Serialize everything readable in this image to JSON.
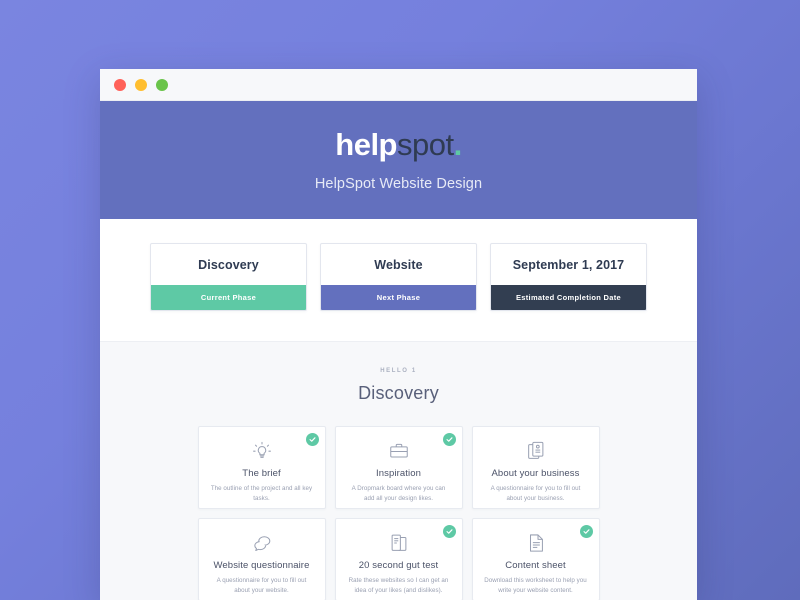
{
  "window": {
    "traffic_lights": [
      "close-red",
      "minimize-yellow",
      "maximize-green"
    ]
  },
  "hero": {
    "logo_part1": "help",
    "logo_part2": "spot",
    "logo_dot": ".",
    "subtitle": "HelpSpot Website Design",
    "background_color": "#6370be"
  },
  "phases": [
    {
      "title": "Discovery",
      "band_label": "Current Phase",
      "band_color": "#5ec9a5"
    },
    {
      "title": "Website",
      "band_label": "Next Phase",
      "band_color": "#6370be"
    },
    {
      "title": "September 1, 2017",
      "band_label": "Estimated Completion Date",
      "band_color": "#323e51"
    }
  ],
  "section": {
    "eyebrow": "HELLO 1",
    "heading": "Discovery"
  },
  "tasks": [
    {
      "icon": "lightbulb-icon",
      "title": "The brief",
      "description": "The outline of the project and all key tasks.",
      "completed": true
    },
    {
      "icon": "briefcase-icon",
      "title": "Inspiration",
      "description": "A Dropmark board where you can add all your design likes.",
      "completed": true
    },
    {
      "icon": "clipboard-stack-icon",
      "title": "About your business",
      "description": "A questionnaire for you to fill out about your business.",
      "completed": false
    },
    {
      "icon": "speech-bubbles-icon",
      "title": "Website questionnaire",
      "description": "A questionnaire for you to fill out about your website.",
      "completed": false
    },
    {
      "icon": "pages-icon",
      "title": "20 second gut test",
      "description": "Rate these websites so I can get an idea of your likes (and dislikes).",
      "completed": true
    },
    {
      "icon": "document-lines-icon",
      "title": "Content sheet",
      "description": "Download this worksheet to help you write your website content.",
      "completed": true
    }
  ],
  "colors": {
    "page_background_start": "#7a85e0",
    "page_background_end": "#5f6cbc",
    "accent_green": "#5ec9a5",
    "accent_purple": "#6370be",
    "accent_dark": "#323e51"
  }
}
